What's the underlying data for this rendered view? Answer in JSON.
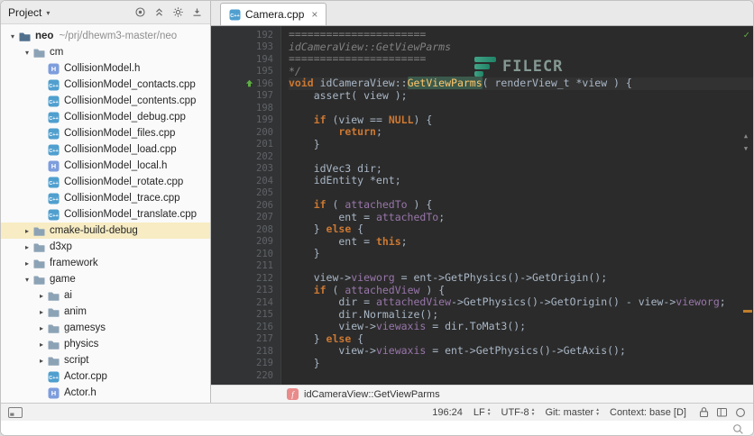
{
  "project_panel": {
    "title": "Project",
    "header_icons": [
      "locate-icon",
      "collapse-all-icon",
      "settings-gear-icon",
      "hide-panel-icon"
    ],
    "tree": [
      {
        "label": "neo",
        "hint": "~/prj/dhewm3-master/neo",
        "level": 0,
        "kind": "folder-root",
        "chevron": "expanded"
      },
      {
        "label": "cm",
        "level": 1,
        "kind": "folder",
        "chevron": "expanded"
      },
      {
        "label": "CollisionModel.h",
        "level": 2,
        "kind": "file-h"
      },
      {
        "label": "CollisionModel_contacts.cpp",
        "level": 2,
        "kind": "file-cpp"
      },
      {
        "label": "CollisionModel_contents.cpp",
        "level": 2,
        "kind": "file-cpp"
      },
      {
        "label": "CollisionModel_debug.cpp",
        "level": 2,
        "kind": "file-cpp"
      },
      {
        "label": "CollisionModel_files.cpp",
        "level": 2,
        "kind": "file-cpp"
      },
      {
        "label": "CollisionModel_load.cpp",
        "level": 2,
        "kind": "file-cpp"
      },
      {
        "label": "CollisionModel_local.h",
        "level": 2,
        "kind": "file-h"
      },
      {
        "label": "CollisionModel_rotate.cpp",
        "level": 2,
        "kind": "file-cpp"
      },
      {
        "label": "CollisionModel_trace.cpp",
        "level": 2,
        "kind": "file-cpp"
      },
      {
        "label": "CollisionModel_translate.cpp",
        "level": 2,
        "kind": "file-cpp"
      },
      {
        "label": "cmake-build-debug",
        "level": 1,
        "kind": "folder",
        "chevron": "collapsed",
        "highlight": true
      },
      {
        "label": "d3xp",
        "level": 1,
        "kind": "folder",
        "chevron": "collapsed"
      },
      {
        "label": "framework",
        "level": 1,
        "kind": "folder",
        "chevron": "collapsed"
      },
      {
        "label": "game",
        "level": 1,
        "kind": "folder",
        "chevron": "expanded"
      },
      {
        "label": "ai",
        "level": 2,
        "kind": "folder",
        "chevron": "collapsed"
      },
      {
        "label": "anim",
        "level": 2,
        "kind": "folder",
        "chevron": "collapsed"
      },
      {
        "label": "gamesys",
        "level": 2,
        "kind": "folder",
        "chevron": "collapsed"
      },
      {
        "label": "physics",
        "level": 2,
        "kind": "folder",
        "chevron": "collapsed"
      },
      {
        "label": "script",
        "level": 2,
        "kind": "folder",
        "chevron": "collapsed"
      },
      {
        "label": "Actor.cpp",
        "level": 2,
        "kind": "file-cpp"
      },
      {
        "label": "Actor.h",
        "level": 2,
        "kind": "file-h"
      }
    ]
  },
  "editor": {
    "tab": {
      "label": "Camera.cpp"
    },
    "first_line_number": 192,
    "caret_line": 196,
    "watermark_text": "FILECR",
    "breadcrumb": {
      "label": "idCameraView::GetViewParms"
    },
    "lines": [
      [
        [
          "cmt",
          "======================"
        ]
      ],
      [
        [
          "cmt",
          "idCameraView::GetViewParms"
        ]
      ],
      [
        [
          "cmt",
          "======================"
        ]
      ],
      [
        [
          "cmt",
          "*/"
        ]
      ],
      [
        [
          "kw",
          "void"
        ],
        [
          "def",
          " idCameraView::"
        ],
        [
          "hl",
          "GetViewParms"
        ],
        [
          "def",
          "( renderView_t *view ) {"
        ]
      ],
      [
        [
          "def",
          "    assert( view );"
        ]
      ],
      [],
      [
        [
          "def",
          "    "
        ],
        [
          "kw",
          "if"
        ],
        [
          "def",
          " (view == "
        ],
        [
          "kw",
          "NULL"
        ],
        [
          "def",
          ") {"
        ]
      ],
      [
        [
          "def",
          "        "
        ],
        [
          "kw",
          "return"
        ],
        [
          "def",
          ";"
        ]
      ],
      [
        [
          "def",
          "    }"
        ]
      ],
      [],
      [
        [
          "def",
          "    idVec3 dir;"
        ]
      ],
      [
        [
          "def",
          "    idEntity *ent;"
        ]
      ],
      [],
      [
        [
          "def",
          "    "
        ],
        [
          "kw",
          "if"
        ],
        [
          "def",
          " ( "
        ],
        [
          "fld",
          "attachedTo"
        ],
        [
          "def",
          " ) {"
        ]
      ],
      [
        [
          "def",
          "        ent = "
        ],
        [
          "fld",
          "attachedTo"
        ],
        [
          "def",
          ";"
        ]
      ],
      [
        [
          "def",
          "    } "
        ],
        [
          "kw",
          "else"
        ],
        [
          "def",
          " {"
        ]
      ],
      [
        [
          "def",
          "        ent = "
        ],
        [
          "kw",
          "this"
        ],
        [
          "def",
          ";"
        ]
      ],
      [
        [
          "def",
          "    }"
        ]
      ],
      [],
      [
        [
          "def",
          "    view->"
        ],
        [
          "fld",
          "vieworg"
        ],
        [
          "def",
          " = ent->GetPhysics()->GetOrigin();"
        ]
      ],
      [
        [
          "def",
          "    "
        ],
        [
          "kw",
          "if"
        ],
        [
          "def",
          " ( "
        ],
        [
          "fld",
          "attachedView"
        ],
        [
          "def",
          " ) {"
        ]
      ],
      [
        [
          "def",
          "        dir = "
        ],
        [
          "fld",
          "attachedView"
        ],
        [
          "def",
          "->GetPhysics()->GetOrigin() - view->"
        ],
        [
          "fld",
          "vieworg"
        ],
        [
          "def",
          ";"
        ]
      ],
      [
        [
          "def",
          "        dir.Normalize();"
        ]
      ],
      [
        [
          "def",
          "        view->"
        ],
        [
          "fld",
          "viewaxis"
        ],
        [
          "def",
          " = dir.ToMat3();"
        ]
      ],
      [
        [
          "def",
          "    } "
        ],
        [
          "kw",
          "else"
        ],
        [
          "def",
          " {"
        ]
      ],
      [
        [
          "def",
          "        view->"
        ],
        [
          "fld",
          "viewaxis"
        ],
        [
          "def",
          " = ent->GetPhysics()->GetAxis();"
        ]
      ],
      [
        [
          "def",
          "    }"
        ]
      ],
      []
    ]
  },
  "status_bar": {
    "caret_position": "196:24",
    "line_separator": "LF",
    "encoding": "UTF-8",
    "git_branch": "Git: master",
    "context": "Context: base [D]"
  },
  "icons": {
    "chevron_expanded": "▾",
    "chevron_collapsed": "▸",
    "dropdown_caret": "▾",
    "tab_close": "×",
    "inspection_check": "✓",
    "scroll_up": "▲",
    "scroll_down": "▼",
    "selector_up": "▴",
    "selector_down": "▾",
    "function_badge": "f",
    "cpp_badge": "C++",
    "header_badge": "H"
  },
  "colors": {
    "editor_bg": "#2b2b2b",
    "gutter_bg": "#313335",
    "keyword": "#cc7832",
    "comment": "#808080",
    "field": "#9876aa",
    "function_decl": "#ffc66b",
    "identifier_highlight_bg": "#3b5a4c",
    "check_green": "#5fad43",
    "warning_stripe": "#c07f2a",
    "modified_row_bg": "#f7ecc3"
  }
}
